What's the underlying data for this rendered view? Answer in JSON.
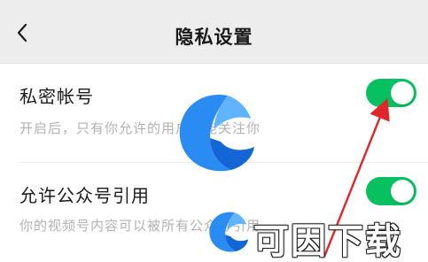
{
  "header": {
    "title": "隐私设置",
    "back_icon": "chevron-left-icon"
  },
  "settings": [
    {
      "label": "私密帐号",
      "description": "开启后，只有你允许的用户才能关注你",
      "enabled": true
    },
    {
      "label": "允许公众号引用",
      "description": "你的视频号内容可以被所有公众号引用",
      "enabled": true
    }
  ],
  "watermark": {
    "text": "可因下载"
  },
  "colors": {
    "toggle_on": "#07c160",
    "header_bg": "#ededed",
    "annotation_arrow": "#e0262b",
    "logo_blue": "#1e7ff0"
  }
}
